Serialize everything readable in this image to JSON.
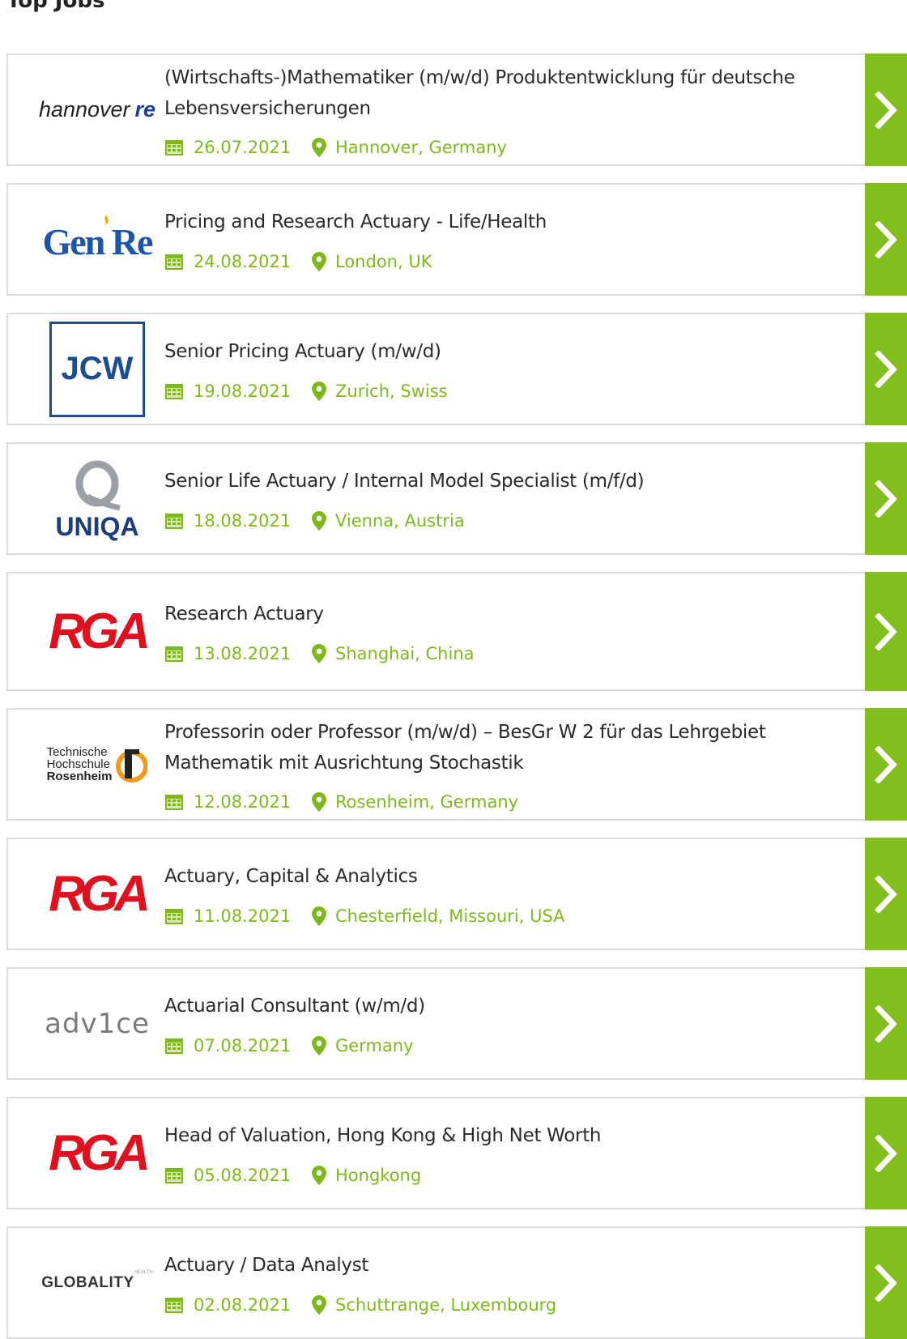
{
  "section_title": "Top Jobs",
  "colors": {
    "accent": "#82be1c",
    "meta_text": "#7fb81a",
    "border": "#dadada",
    "rga_red": "#e0101f",
    "jcw_blue": "#1d4d8f"
  },
  "jobs": [
    {
      "title": "(Wirtschafts-)Mathematiker (m/w/d) Produktentwicklung für deutsche Lebensversicherungen",
      "date": "26.07.2021",
      "location": "Hannover, Germany",
      "logo": "hannover re"
    },
    {
      "title": "Pricing and Research Actuary - Life/Health",
      "date": "24.08.2021",
      "location": "London, UK",
      "logo": "Gen Re"
    },
    {
      "title": "Senior Pricing Actuary (m/w/d)",
      "date": "19.08.2021",
      "location": "Zurich, Swiss",
      "logo": "JCW"
    },
    {
      "title": "Senior Life Actuary / Internal Model Specialist (m/f/d)",
      "date": "18.08.2021",
      "location": "Vienna, Austria",
      "logo": "UNIQA"
    },
    {
      "title": "Research Actuary",
      "date": "13.08.2021",
      "location": "Shanghai, China",
      "logo": "RGA"
    },
    {
      "title": "Professorin oder Professor (m/w/d) – BesGr W 2 für das Lehrgebiet Mathematik mit Ausrichtung Stochastik",
      "date": "12.08.2021",
      "location": "Rosenheim, Germany",
      "logo": "Technische Hochschule Rosenheim"
    },
    {
      "title": "Actuary, Capital & Analytics",
      "date": "11.08.2021",
      "location": "Chesterfield, Missouri, USA",
      "logo": "RGA"
    },
    {
      "title": "Actuarial Consultant (w/m/d)",
      "date": "07.08.2021",
      "location": "Germany",
      "logo": "adv1ce"
    },
    {
      "title": "Head of Valuation, Hong Kong & High Net Worth",
      "date": "05.08.2021",
      "location": "Hongkong",
      "logo": "RGA"
    },
    {
      "title": "Actuary / Data Analyst",
      "date": "02.08.2021",
      "location": "Schuttrange,  Luxembourg",
      "logo": "GLOBALITY"
    }
  ],
  "logos": {
    "hannover": {
      "word": "hannover",
      "re": "re"
    },
    "genre": {
      "text": "Gen Re"
    },
    "jcw": {
      "text": "JCW"
    },
    "uniqa": {
      "text": "UNIQA"
    },
    "rga": {
      "text": "RGA"
    },
    "th": {
      "l1": "Technische",
      "l2": "Hochschule",
      "l3": "Rosenheim"
    },
    "advice": {
      "text": "adv1ce"
    },
    "globality": {
      "text": "GLOBALITY",
      "sup": "HEALTH"
    }
  }
}
